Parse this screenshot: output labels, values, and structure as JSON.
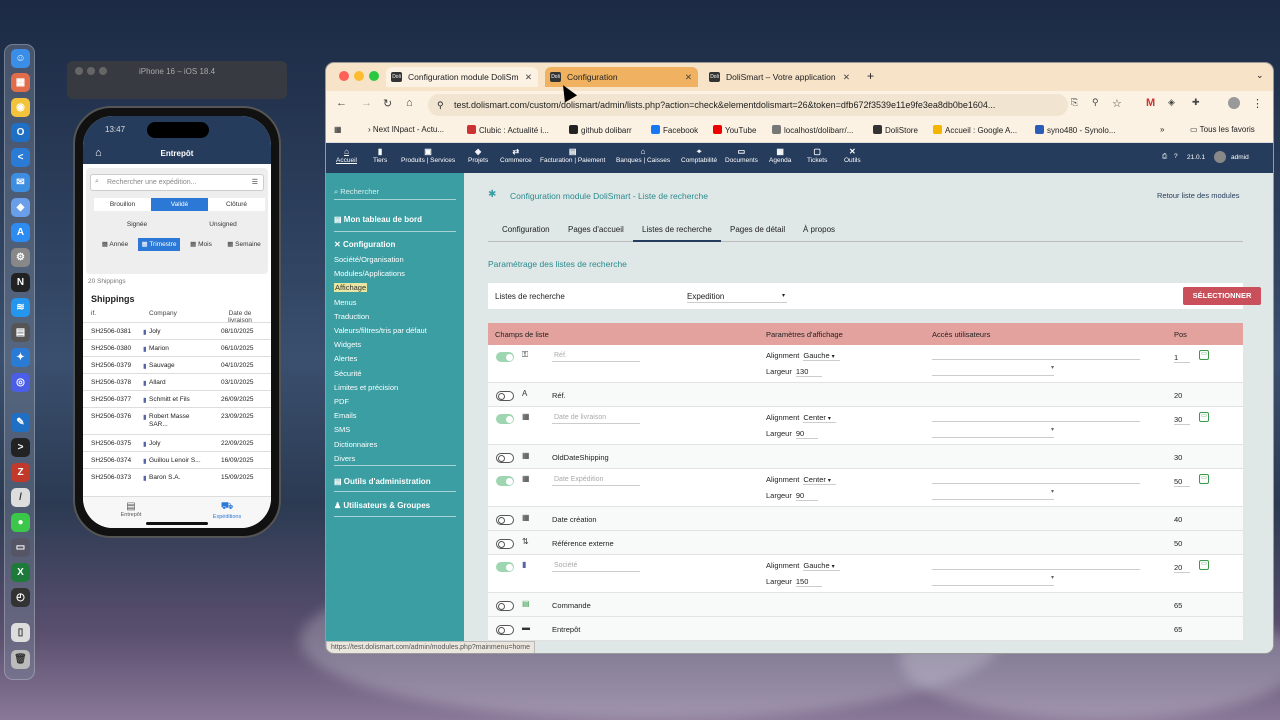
{
  "simulator": {
    "title": "iPhone 16 – iOS 18.4"
  },
  "phone": {
    "time": "13:47",
    "header_title": "Entrepôt",
    "search_placeholder": "Rechercher une expédition...",
    "status_filters": [
      "Brouillon",
      "Validé",
      "Clôturé"
    ],
    "sign_filters": [
      "Signée",
      "Unsigned"
    ],
    "period_filters": [
      "Année",
      "Trimestre",
      "Mois",
      "Semaine"
    ],
    "count_text": "20 Shippings",
    "list_title": "Shippings",
    "columns": [
      "if.",
      "Company",
      "Date de livraison"
    ],
    "rows": [
      {
        "ref": "SH2506-0381",
        "company": "Joly",
        "date": "08/10/2025"
      },
      {
        "ref": "SH2506-0380",
        "company": "Marion",
        "date": "06/10/2025"
      },
      {
        "ref": "SH2506-0379",
        "company": "Sauvage",
        "date": "04/10/2025"
      },
      {
        "ref": "SH2506-0378",
        "company": "Allard",
        "date": "03/10/2025"
      },
      {
        "ref": "SH2506-0377",
        "company": "Schmitt et Fils",
        "date": "26/09/2025"
      },
      {
        "ref": "SH2506-0376",
        "company": "Robert Masse SAR...",
        "date": "23/09/2025"
      },
      {
        "ref": "SH2506-0375",
        "company": "Joly",
        "date": "22/09/2025"
      },
      {
        "ref": "SH2506-0374",
        "company": "Guillou Lenoir S...",
        "date": "16/09/2025"
      },
      {
        "ref": "SH2506-0373",
        "company": "Baron S.A.",
        "date": "15/09/2025"
      }
    ],
    "tabs": [
      "Entrepôt",
      "Expéditions"
    ]
  },
  "browser": {
    "tabs": [
      {
        "label": "Configuration module DoliSm",
        "favicon": "Doli"
      },
      {
        "label": "Configuration",
        "favicon": "Doli"
      },
      {
        "label": "DoliSmart – Votre application",
        "favicon": "Doli"
      }
    ],
    "url": "test.dolismart.com/custom/dolismart/admin/lists.php?action=check&elementdolismart=26&token=dfb672f3539e11e9fe3ea8db0be1604...",
    "bookmarks": [
      "Next INpact - Actu...",
      "Clubic : Actualité i...",
      "github dolibarr",
      "Facebook",
      "YouTube",
      "localhost/dolibarr/...",
      "DoliStore",
      "Accueil : Google A...",
      "syno480 - Synolo..."
    ],
    "bookmarks_all": "Tous les favoris",
    "status_url": "https://test.dolismart.com/admin/modules.php?mainmenu=home"
  },
  "dolibarr": {
    "topnav": [
      "Accueil",
      "Tiers",
      "Produits | Services",
      "Projets",
      "Commerce",
      "Facturation | Paiement",
      "Banques | Caisses",
      "Comptabilité",
      "Documents",
      "Agenda",
      "Tickets",
      "Outils"
    ],
    "version": "21.0.1",
    "user": "admid",
    "sidebar": {
      "search": "Rechercher",
      "dashboard": "Mon tableau de bord",
      "config": "Configuration",
      "items": [
        "Société/Organisation",
        "Modules/Applications",
        "Affichage",
        "Menus",
        "Traduction",
        "Valeurs/filtres/tris par défaut",
        "Widgets",
        "Alertes",
        "Sécurité",
        "Limites et précision",
        "PDF",
        "Emails",
        "SMS",
        "Dictionnaires",
        "Divers"
      ],
      "admin_tools": "Outils d'administration",
      "users": "Utilisateurs & Groupes"
    },
    "page_title": "Configuration module DoliSmart - Liste de recherche",
    "back_link": "Retour liste des modules",
    "tabs": [
      "Configuration",
      "Pages d'accueil",
      "Listes de recherche",
      "Pages de détail",
      "À propos"
    ],
    "section_title": "Paramétrage des listes de recherche",
    "list_label": "Listes de recherche",
    "list_value": "Expedition",
    "select_button": "SÉLECTIONNER",
    "table_headers": [
      "Champs de liste",
      "Paramètres d'affichage",
      "Accès utilisateurs",
      "Pos"
    ],
    "rows": [
      {
        "on": true,
        "icon": "key-icon",
        "field": "Réf.",
        "align": "Gauche",
        "width": "130",
        "pos": "1",
        "editable": true
      },
      {
        "on": false,
        "icon": "font-icon",
        "field": "Réf.",
        "pos": "20",
        "editable": false
      },
      {
        "on": true,
        "icon": "calendar-icon",
        "field": "Date de livraison",
        "align": "Center",
        "width": "90",
        "pos": "30",
        "editable": true
      },
      {
        "on": false,
        "icon": "calendar-icon",
        "field": "OldDateShipping",
        "pos": "30",
        "editable": false
      },
      {
        "on": true,
        "icon": "calendar-icon",
        "field": "Date Expédition",
        "align": "Center",
        "width": "90",
        "pos": "50",
        "editable": true
      },
      {
        "on": false,
        "icon": "calendar-icon",
        "field": "Date création",
        "pos": "40",
        "editable": false
      },
      {
        "on": false,
        "icon": "sort-icon",
        "field": "Référence externe",
        "pos": "50",
        "editable": false
      },
      {
        "on": true,
        "icon": "building-icon",
        "field": "Société",
        "align": "Gauche",
        "width": "150",
        "pos": "20",
        "editable": true
      },
      {
        "on": false,
        "icon": "file-icon",
        "field": "Commande",
        "pos": "65",
        "editable": false
      },
      {
        "on": false,
        "icon": "warehouse-icon",
        "field": "Entrepôt",
        "pos": "65",
        "editable": false
      }
    ],
    "align_label": "Alignment",
    "width_label": "Largeur"
  }
}
